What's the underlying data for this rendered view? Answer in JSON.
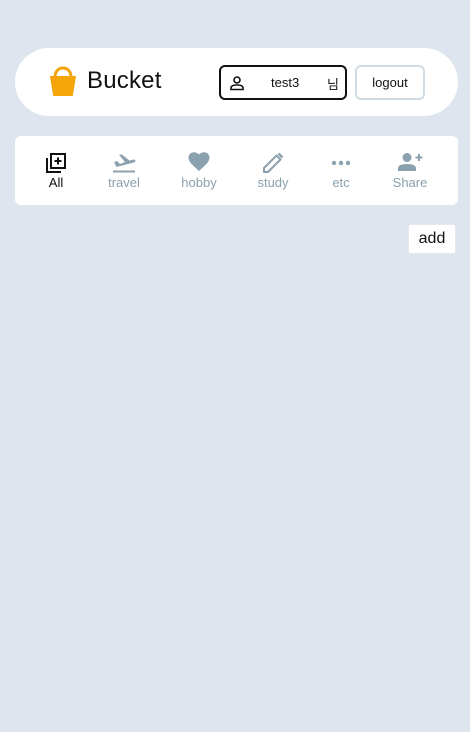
{
  "app": {
    "title": "Bucket"
  },
  "user": {
    "name": "test3",
    "suffix": "님"
  },
  "header": {
    "logout_label": "logout"
  },
  "nav": {
    "items": [
      {
        "label": "All",
        "icon": "library-add-icon",
        "active": true
      },
      {
        "label": "travel",
        "icon": "flight-takeoff-icon",
        "active": false
      },
      {
        "label": "hobby",
        "icon": "heart-icon",
        "active": false
      },
      {
        "label": "study",
        "icon": "pencil-icon",
        "active": false
      },
      {
        "label": "etc",
        "icon": "more-horiz-icon",
        "active": false
      },
      {
        "label": "Share",
        "icon": "person-add-icon",
        "active": false
      }
    ]
  },
  "main": {
    "add_label": "add"
  },
  "colors": {
    "background": "#dee5ee",
    "accent": "#f5a40a",
    "active": "#111111",
    "inactive": "#8ba1ad"
  }
}
